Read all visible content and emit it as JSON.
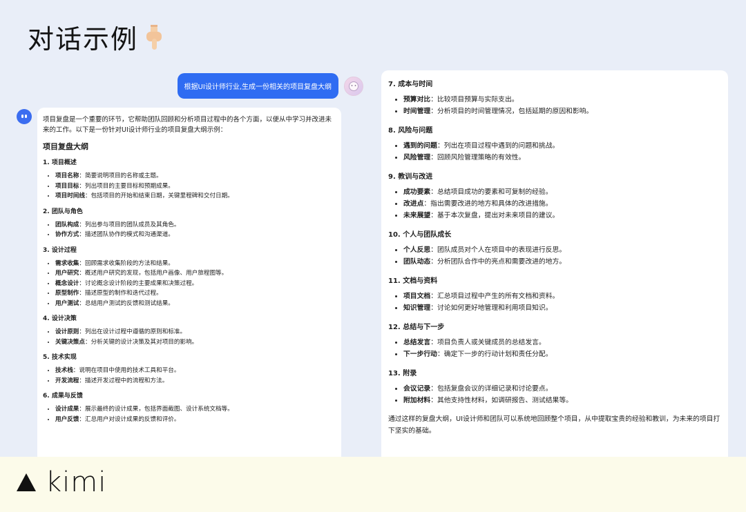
{
  "title": "对话示例",
  "user_message": "根据UI设计师行业,生成一份相关的项目复盘大纲",
  "bot": {
    "intro": "项目复盘是一个重要的环节，它帮助团队回顾和分析项目过程中的各个方面，以便从中学习并改进未来的工作。以下是一份针对UI设计师行业的项目复盘大纲示例：",
    "outline_title": "项目复盘大纲",
    "sections": [
      {
        "title": "1. 项目概述",
        "items": [
          {
            "k": "项目名称",
            "v": "：简要说明项目的名称或主题。"
          },
          {
            "k": "项目目标",
            "v": "：列出项目的主要目标和预期成果。"
          },
          {
            "k": "项目时间线",
            "v": "：包括项目的开始和结束日期，关键里程碑和交付日期。"
          }
        ]
      },
      {
        "title": "2. 团队与角色",
        "items": [
          {
            "k": "团队构成",
            "v": "：列出参与项目的团队成员及其角色。"
          },
          {
            "k": "协作方式",
            "v": "：描述团队协作的模式和沟通渠道。"
          }
        ]
      },
      {
        "title": "3. 设计过程",
        "items": [
          {
            "k": "需求收集",
            "v": "：回顾需求收集阶段的方法和结果。"
          },
          {
            "k": "用户研究",
            "v": "：概述用户研究的发现，包括用户画像、用户旅程图等。"
          },
          {
            "k": "概念设计",
            "v": "：讨论概念设计阶段的主要成果和决策过程。"
          },
          {
            "k": "原型制作",
            "v": "：描述原型的制作和迭代过程。"
          },
          {
            "k": "用户测试",
            "v": "：总结用户测试的反馈和测试结果。"
          }
        ]
      },
      {
        "title": "4. 设计决策",
        "items": [
          {
            "k": "设计原则",
            "v": "：列出在设计过程中遵循的原则和标准。"
          },
          {
            "k": "关键决策点",
            "v": "：分析关键的设计决策及其对项目的影响。"
          }
        ]
      },
      {
        "title": "5. 技术实现",
        "items": [
          {
            "k": "技术栈",
            "v": "：说明在项目中使用的技术工具和平台。"
          },
          {
            "k": "开发流程",
            "v": "：描述开发过程中的流程和方法。"
          }
        ]
      },
      {
        "title": "6. 成果与反馈",
        "items": [
          {
            "k": "设计成果",
            "v": "：展示最终的设计成果，包括界面截图、设计系统文档等。"
          },
          {
            "k": "用户反馈",
            "v": "：汇总用户对设计成果的反馈和评价。"
          }
        ]
      }
    ]
  },
  "right": {
    "sections": [
      {
        "title": "7. 成本与时间",
        "items": [
          {
            "k": "预算对比",
            "v": "：比较项目预算与实际支出。"
          },
          {
            "k": "时间管理",
            "v": "：分析项目的时间管理情况，包括延期的原因和影响。"
          }
        ]
      },
      {
        "title": "8. 风险与问题",
        "items": [
          {
            "k": "遇到的问题",
            "v": "：列出在项目过程中遇到的问题和挑战。"
          },
          {
            "k": "风险管理",
            "v": "：回顾风险管理策略的有效性。"
          }
        ]
      },
      {
        "title": "9. 教训与改进",
        "items": [
          {
            "k": "成功要素",
            "v": "：总结项目成功的要素和可复制的经验。"
          },
          {
            "k": "改进点",
            "v": "：指出需要改进的地方和具体的改进措施。"
          },
          {
            "k": "未来展望",
            "v": "：基于本次复盘，提出对未来项目的建议。"
          }
        ]
      },
      {
        "title": "10. 个人与团队成长",
        "items": [
          {
            "k": "个人反思",
            "v": "：团队成员对个人在项目中的表现进行反思。"
          },
          {
            "k": "团队动态",
            "v": "：分析团队合作中的亮点和需要改进的地方。"
          }
        ]
      },
      {
        "title": "11. 文档与资料",
        "items": [
          {
            "k": "项目文档",
            "v": "：汇总项目过程中产生的所有文档和资料。"
          },
          {
            "k": "知识管理",
            "v": "：讨论如何更好地管理和利用项目知识。"
          }
        ]
      },
      {
        "title": "12. 总结与下一步",
        "items": [
          {
            "k": "总结发言",
            "v": "：项目负责人或关键成员的总结发言。"
          },
          {
            "k": "下一步行动",
            "v": "：确定下一步的行动计划和责任分配。"
          }
        ]
      },
      {
        "title": "13. 附录",
        "items": [
          {
            "k": "会议记录",
            "v": "：包括复盘会议的详细记录和讨论要点。"
          },
          {
            "k": "附加材料",
            "v": "：其他支持性材料，如调研报告、测试结果等。"
          }
        ]
      }
    ],
    "conclusion": "通过这样的复盘大纲，UI设计师和团队可以系统地回顾整个项目，从中提取宝贵的经验和教训，为未来的项目打下坚实的基础。"
  },
  "brand": "kimi",
  "colors": {
    "accent": "#2f6cf2",
    "page_bg": "#e9eef8",
    "footer_bg": "#fcfbea"
  },
  "icons": {
    "title_icon": "pointing-down-hand-icon",
    "brand_icon": "triangle-logo-icon"
  }
}
